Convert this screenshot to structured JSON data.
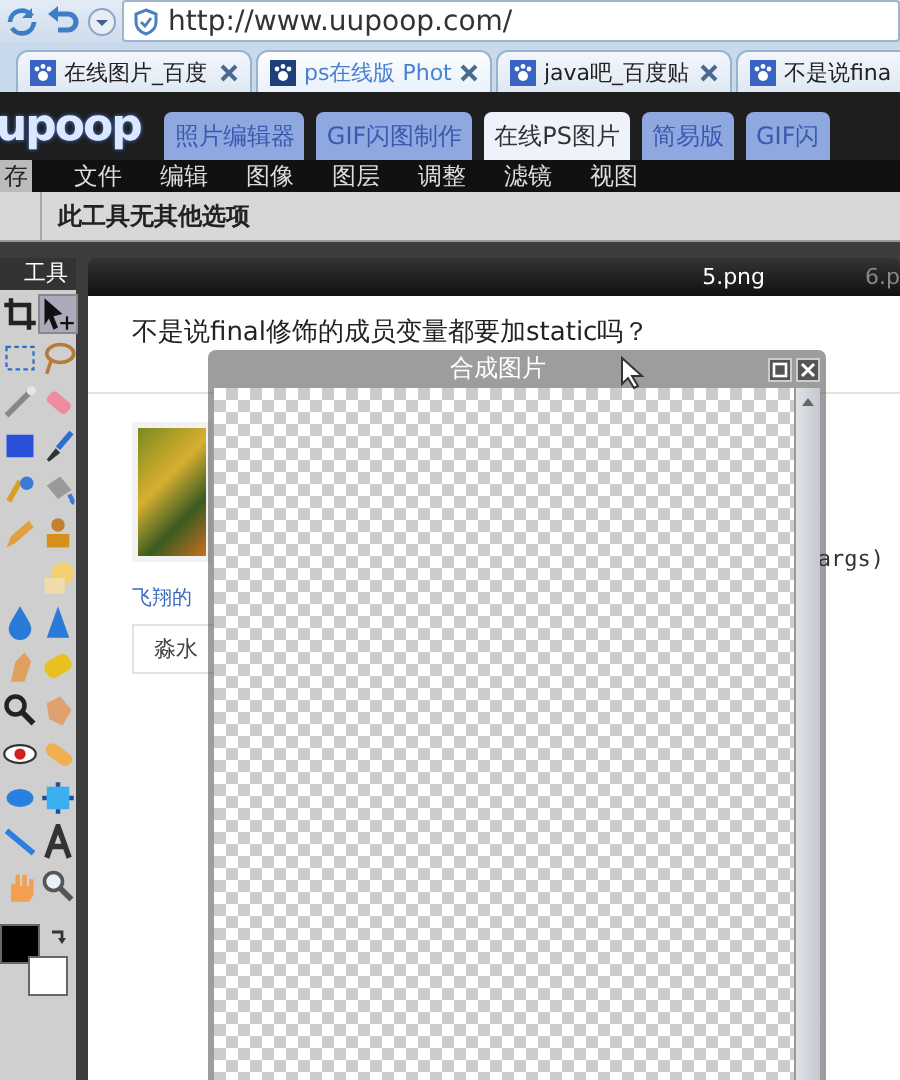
{
  "browser": {
    "address": "http://www.uupoop.com/",
    "tabs": [
      {
        "title": "在线图片_百度",
        "selected": false
      },
      {
        "title": "ps在线版 Phot",
        "selected": true
      },
      {
        "title": "java吧_百度贴",
        "selected": false
      },
      {
        "title": "不是说fina",
        "selected": false
      }
    ]
  },
  "site": {
    "logo": "upoop",
    "nav": [
      {
        "label": "照片编辑器",
        "selected": false
      },
      {
        "label": "GIF闪图制作",
        "selected": false
      },
      {
        "label": "在线PS图片",
        "selected": true
      },
      {
        "label": "简易版",
        "selected": false
      },
      {
        "label": "GIF闪",
        "selected": false
      }
    ]
  },
  "menu": [
    {
      "label": "存",
      "selected": true
    },
    {
      "label": "文件",
      "selected": false
    },
    {
      "label": "编辑",
      "selected": false
    },
    {
      "label": "图像",
      "selected": false
    },
    {
      "label": "图层",
      "selected": false
    },
    {
      "label": "调整",
      "selected": false
    },
    {
      "label": "滤镜",
      "selected": false
    },
    {
      "label": "视图",
      "selected": false
    }
  ],
  "options_bar": "此工具无其他选项",
  "tools_panel": {
    "title": "工具",
    "tools": [
      {
        "kind": "crop",
        "selected": false
      },
      {
        "kind": "move",
        "selected": true
      },
      {
        "kind": "marquee",
        "selected": false
      },
      {
        "kind": "lasso",
        "selected": false
      },
      {
        "kind": "wand",
        "selected": false
      },
      {
        "kind": "eraser",
        "selected": false
      },
      {
        "kind": "rect",
        "selected": false
      },
      {
        "kind": "brush",
        "selected": false
      },
      {
        "kind": "replace",
        "selected": false
      },
      {
        "kind": "bucket",
        "selected": false
      },
      {
        "kind": "pencil",
        "selected": false
      },
      {
        "kind": "stamp",
        "selected": false
      },
      {
        "kind": "blank"
      },
      {
        "kind": "shape",
        "selected": false
      },
      {
        "kind": "drop",
        "selected": false
      },
      {
        "kind": "sharpen",
        "selected": false
      },
      {
        "kind": "smudge",
        "selected": false
      },
      {
        "kind": "sponge",
        "selected": false
      },
      {
        "kind": "dodge",
        "selected": false
      },
      {
        "kind": "burn",
        "selected": false
      },
      {
        "kind": "redeye",
        "selected": false
      },
      {
        "kind": "bandage",
        "selected": false
      },
      {
        "kind": "bloat",
        "selected": false
      },
      {
        "kind": "pinch",
        "selected": false
      },
      {
        "kind": "line",
        "selected": false
      },
      {
        "kind": "type",
        "selected": false
      },
      {
        "kind": "hand",
        "selected": false
      },
      {
        "kind": "zoom",
        "selected": false
      }
    ]
  },
  "document_tabs": [
    {
      "title": "5.png",
      "selected": true
    },
    {
      "title": "6.p",
      "selected": false
    }
  ],
  "page": {
    "question": "不是说final修饰的成员变量都要加static吗？",
    "code_fragment": "args)",
    "link": "飞翔的",
    "reply_box": "淼水"
  },
  "dialog": {
    "title": "合成图片"
  }
}
